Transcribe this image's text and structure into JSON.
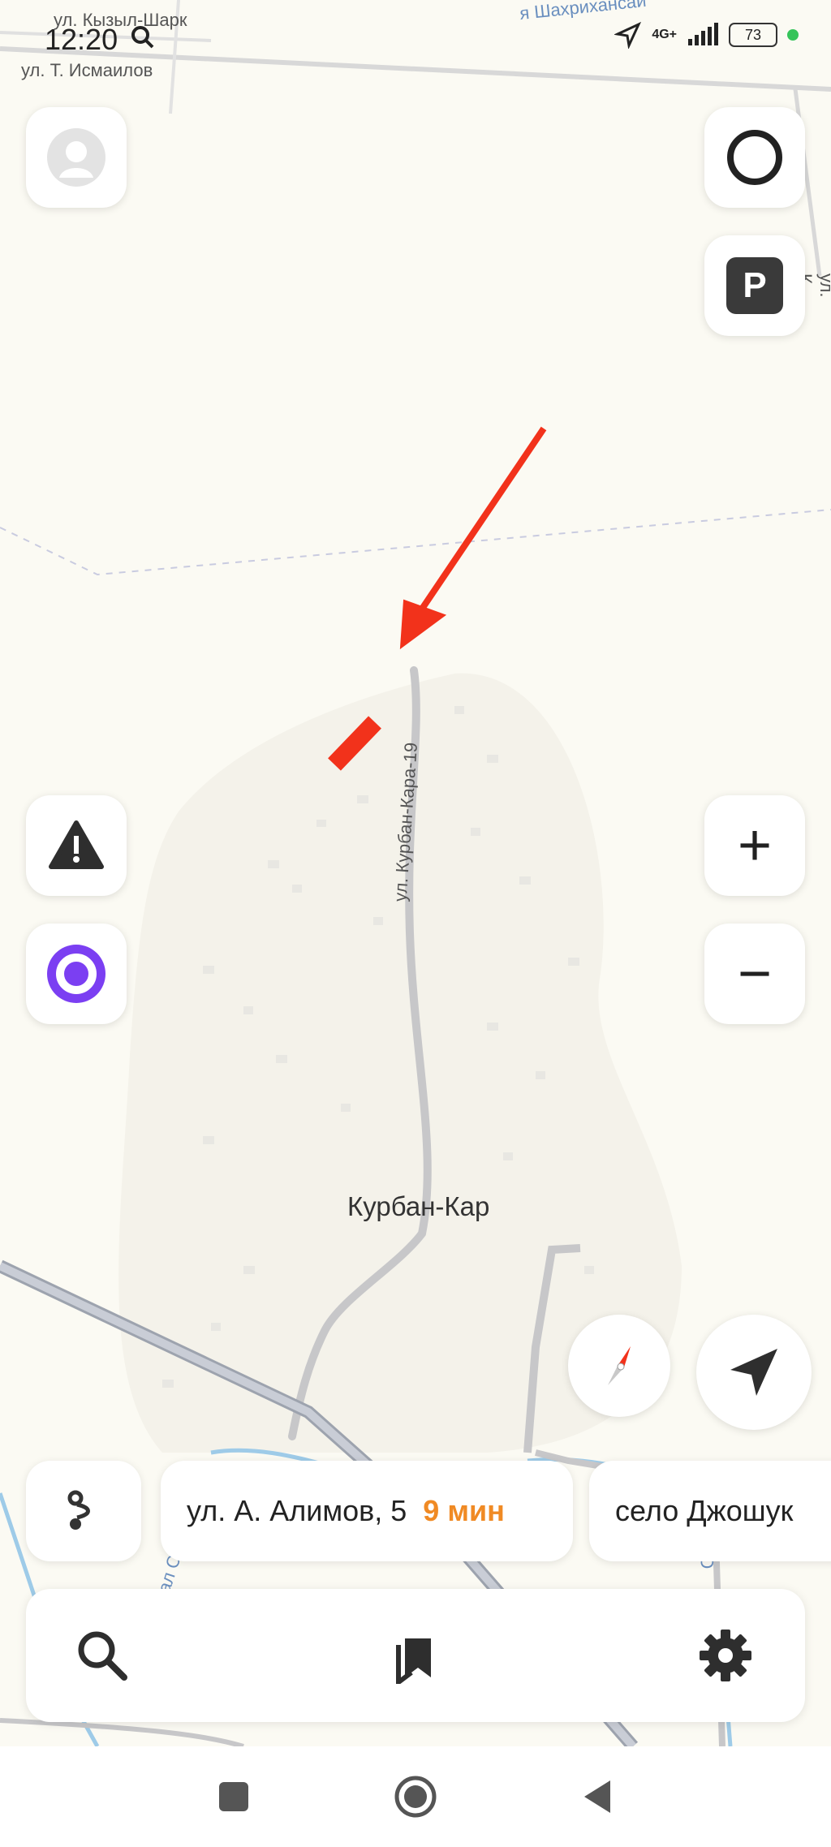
{
  "status_bar": {
    "time": "12:20",
    "network": "4G+",
    "battery": "73"
  },
  "map": {
    "streets": {
      "kyzyl_shark": "ул. Кызыл-Шарк",
      "ismailov": "ул. Т. Исмаилов",
      "shahrikhansay": "я Шахрихансай",
      "kurban_kara": "ул. Курбан-Кара-19",
      "right_edge": "ул. К",
      "canal": "канал Савай",
      "canal_right": "Сай"
    },
    "place": "Курбан-Кар",
    "annotation_color": "#f2321b"
  },
  "buttons": {
    "profile": "avatar-icon",
    "alice_top": "alice-ring-icon",
    "parking_label": "P",
    "warning": "warning-icon",
    "alice": "alice-icon",
    "zoom_in": "+",
    "zoom_out": "−",
    "compass": "compass-icon",
    "locate": "locate-arrow-icon"
  },
  "routes": [
    {
      "address": "ул. А. Алимов, 5",
      "eta": "9 мин"
    },
    {
      "address": "село Джошук",
      "eta": ""
    }
  ],
  "bottom_bar": {
    "search": "search-icon",
    "bookmarks": "bookmarks-icon",
    "settings": "gear-icon"
  },
  "nav_bar": {
    "recents": "square-icon",
    "home": "circle-icon",
    "back": "triangle-icon"
  }
}
